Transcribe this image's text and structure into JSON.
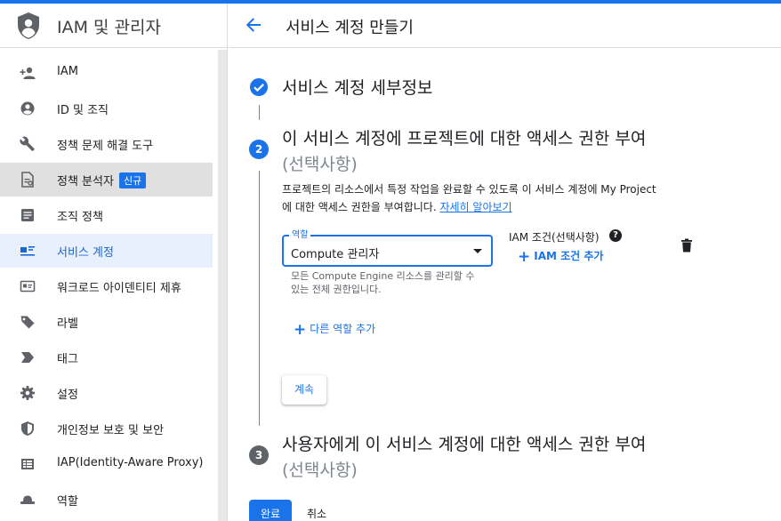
{
  "colors": {
    "accent": "#1a73e8",
    "selected_bg": "#e0e0e0",
    "active_bg": "#e8f0fe",
    "complete": "#1a73e8",
    "pending": "#5f6368"
  },
  "sidebar": {
    "title": "IAM 및 관리자",
    "logo_icon": "iam-shield-icon",
    "items": [
      {
        "label": "IAM",
        "icon": "person-add-icon"
      },
      {
        "label": "ID 및 조직",
        "icon": "account-circle-icon"
      },
      {
        "label": "정책 문제 해결 도구",
        "icon": "wrench-icon"
      },
      {
        "label": "정책 분석자",
        "icon": "policy-document-icon",
        "badge": "신규"
      },
      {
        "label": "조직 정책",
        "icon": "list-alt-icon"
      },
      {
        "label": "서비스 계정",
        "icon": "service-account-icon"
      },
      {
        "label": "워크로드 아이덴티티 제휴",
        "icon": "badge-card-icon"
      },
      {
        "label": "라벨",
        "icon": "label-icon"
      },
      {
        "label": "태그",
        "icon": "tag-arrow-icon"
      },
      {
        "label": "설정",
        "icon": "gear-icon"
      },
      {
        "label": "개인정보 보호 및 보안",
        "icon": "shield-icon"
      },
      {
        "label": "IAP(Identity-Aware Proxy)",
        "icon": "iap-icon"
      },
      {
        "label": "역할",
        "icon": "hat-icon"
      }
    ]
  },
  "header": {
    "title": "서비스 계정 만들기",
    "back_icon": "arrow-back-icon"
  },
  "steps": {
    "step1": {
      "title": "서비스 계정 세부정보",
      "status_icon": "check-circle-icon"
    },
    "step2": {
      "number": "2",
      "title": "이 서비스 계정에 프로젝트에 대한 액세스 권한 부여",
      "optional": "(선택사항)",
      "description_line1": "프로젝트의 리소스에서 특정 작업을 완료할 수 있도록 이 서비스 계정에 My Project",
      "description_line2": "에 대한 액세스 권한을 부여합니다.",
      "learn_more": "자세히 알아보기",
      "role_label": "역할",
      "role_value": "Compute 관리자",
      "role_help": "모든 Compute Engine 리소스를 관리할 수 있는 전체 권한입니다.",
      "iam_condition_label": "IAM 조건(선택사항)",
      "add_iam_condition": "IAM 조건 추가",
      "add_role": "다른 역할 추가",
      "continue": "계속"
    },
    "step3": {
      "number": "3",
      "title": "사용자에게 이 서비스 계정에 대한 액세스 권한 부여",
      "optional": "(선택사항)"
    }
  },
  "footer": {
    "done": "완료",
    "cancel": "취소"
  }
}
